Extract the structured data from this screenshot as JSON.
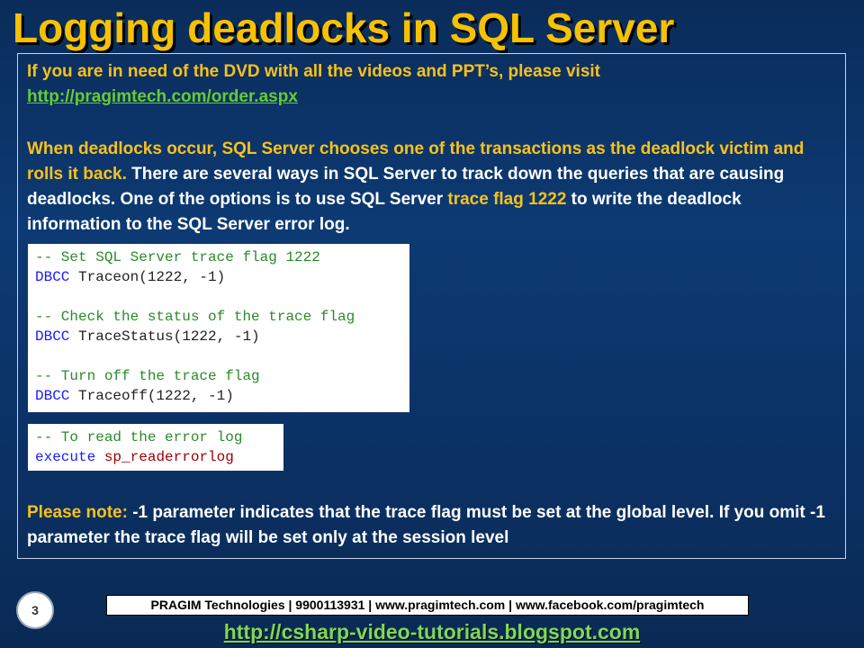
{
  "slide": {
    "title": "Logging deadlocks in SQL Server",
    "intro": {
      "text": "If you are in need of the DVD with all the videos and PPT’s, please visit",
      "link": "http://pragimtech.com/order.aspx"
    },
    "body": {
      "highlight": "When deadlocks occur, SQL Server chooses one of the transactions as the deadlock victim and rolls it back.",
      "text1": " There are several ways in SQL Server to track down the queries that are causing deadlocks. One of the options is to use SQL Server ",
      "flag": "trace flag 1222",
      "text2": " to write the deadlock information to the SQL Server error log."
    },
    "code_block_1": {
      "line1_comment": "-- Set SQL Server trace flag 1222",
      "line2_kw": "DBCC",
      "line2_fn": " Traceon",
      "line2_args": "(1222, -1)",
      "line4_comment": "-- Check the status of the trace flag",
      "line5_kw": "DBCC",
      "line5_fn": " TraceStatus",
      "line5_args": "(1222, -1)",
      "line7_comment": "-- Turn off the trace flag",
      "line8_kw": "DBCC",
      "line8_fn": " Traceoff",
      "line8_args": "(1222, -1)"
    },
    "code_block_2": {
      "line1_comment": "-- To read the error log",
      "line2_kw": "execute",
      "line2_proc": "sp_readerrorlog"
    },
    "note": {
      "label": "Please note:",
      "text": " -1 parameter indicates that the trace flag must be set at the global level. If you omit -1 parameter the trace flag will be set only at the session level"
    },
    "page_number": "3",
    "footer": "PRAGIM Technologies | 9900113931 | www.pragimtech.com | www.facebook.com/pragimtech",
    "blog_link": "http://csharp-video-tutorials.blogspot.com"
  }
}
